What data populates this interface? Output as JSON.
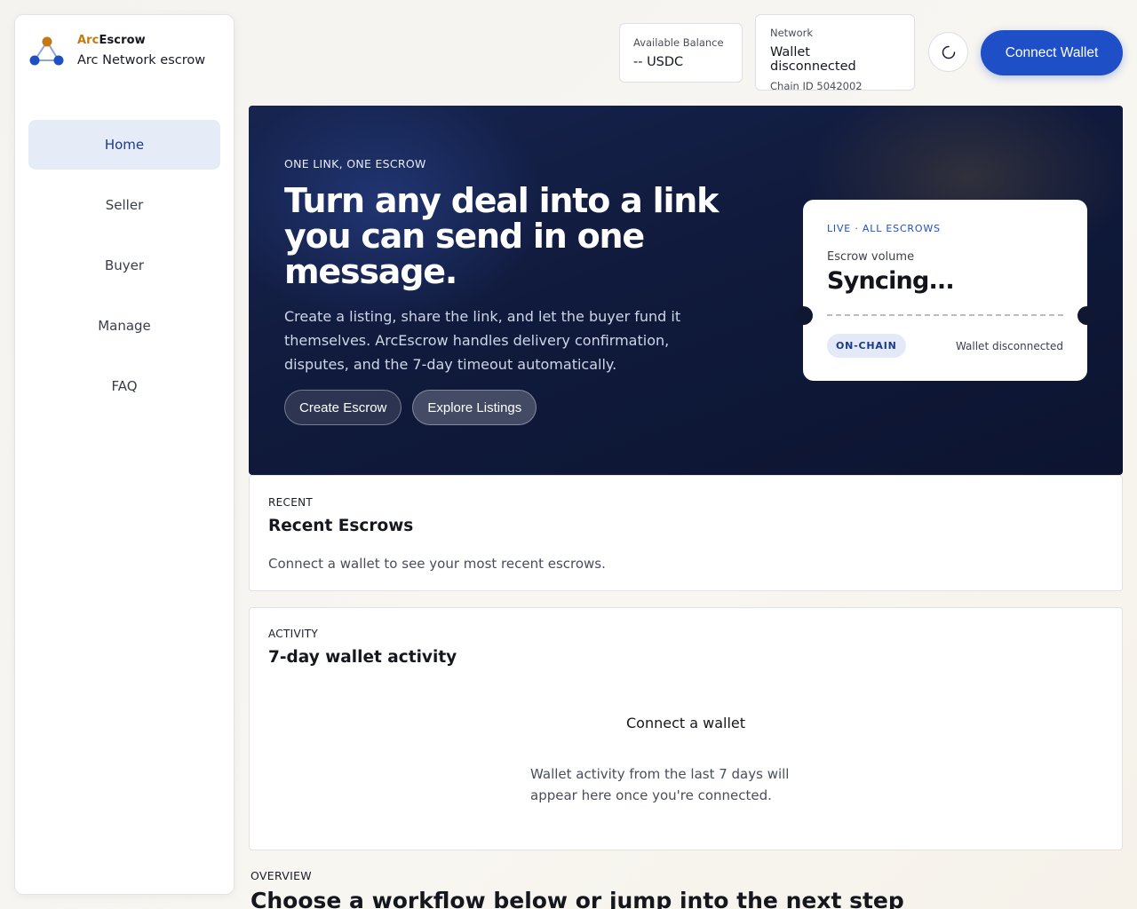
{
  "brand": {
    "name_part1": "Arc",
    "name_part2": "Escrow",
    "subtitle": "Arc Network escrow",
    "colors": {
      "accent": "#c27a10",
      "node": "#1e4fc7"
    }
  },
  "nav": {
    "items": [
      {
        "label": "Home",
        "active": true
      },
      {
        "label": "Seller"
      },
      {
        "label": "Buyer"
      },
      {
        "label": "Manage"
      },
      {
        "label": "FAQ"
      }
    ]
  },
  "topbar": {
    "balance": {
      "label": "Available Balance",
      "value": "-- USDC"
    },
    "network": {
      "label": "Network",
      "value": "Wallet disconnected",
      "chain": "Chain ID 5042002"
    },
    "theme_icon": "loading-spinner-icon",
    "connect_label": "Connect Wallet",
    "colors": {
      "primary": "#1e4fc7"
    }
  },
  "hero": {
    "eyebrow": "ONE LINK, ONE ESCROW",
    "title": "Turn any deal into a link you can send in one message.",
    "description": "Create a listing, share the link, and let the buyer fund it themselves. ArcEscrow handles delivery confirmation, disputes, and the 7-day timeout automatically.",
    "actions": {
      "create": "Create Escrow",
      "explore": "Explore Listings"
    },
    "ticket": {
      "live": "LIVE · ALL ESCROWS",
      "label": "Escrow volume",
      "value": "Syncing...",
      "chip": "ON-CHAIN",
      "status": "Wallet disconnected"
    }
  },
  "recent": {
    "eyebrow": "RECENT",
    "title": "Recent Escrows",
    "text": "Connect a wallet to see your most recent escrows."
  },
  "activity": {
    "eyebrow": "ACTIVITY",
    "title": "7-day wallet activity",
    "empty_title": "Connect a wallet",
    "empty_desc": "Wallet activity from the last 7 days will appear here once you're connected."
  },
  "overview": {
    "eyebrow": "OVERVIEW",
    "title": "Choose a workflow below or jump into the next step"
  }
}
